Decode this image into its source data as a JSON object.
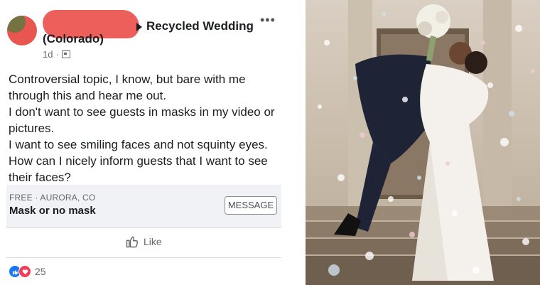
{
  "post": {
    "group_name": "Recycled Wedding",
    "location": "(Colorado)",
    "time": "1d",
    "more": "•••",
    "body_lines": [
      "Controversial topic, I know, but bare with me",
      "through this and hear me out.",
      "I don't want to see guests in masks in my video or",
      "pictures.",
      "I want to see smiling faces and not squinty eyes.",
      "How can I nicely inform guests that I want to see",
      "their faces?"
    ],
    "listing": {
      "subtitle": "FREE · AURORA, CO",
      "title": "Mask or no mask",
      "message_button": "MESSAGE"
    },
    "like_label": "Like",
    "reaction_count": "25"
  },
  "colors": {
    "redaction": "#ec5f5b",
    "like_blue": "#1877f2",
    "love_red": "#f33e58",
    "listing_bg": "#f0f2f5"
  },
  "icons": [
    "more-options-icon",
    "audience-icon",
    "like-thumb-icon",
    "like-reaction-icon",
    "love-reaction-icon"
  ]
}
